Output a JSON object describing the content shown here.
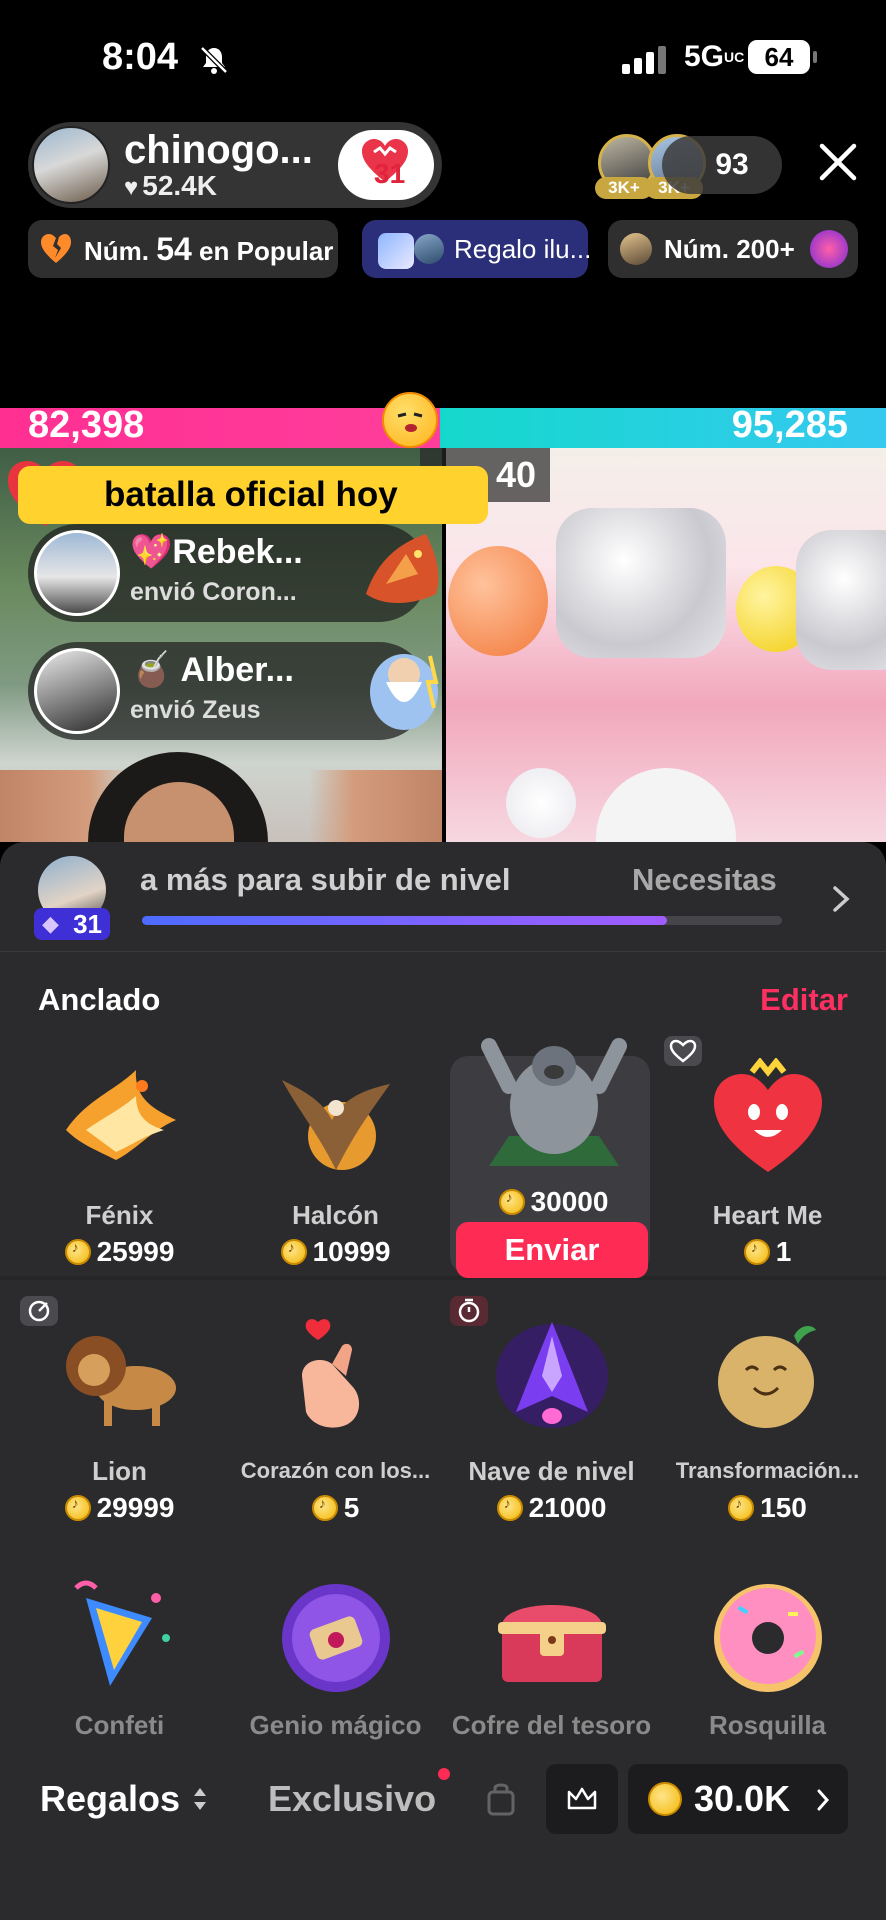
{
  "status_bar": {
    "time": "8:04",
    "network": "5G",
    "network_sup": "UC",
    "battery": "64"
  },
  "host": {
    "name": "chinogo...",
    "likes": "52.4K",
    "badge_number": "31"
  },
  "viewers": {
    "top_tags": [
      "3K+",
      "3K+"
    ],
    "count": "93"
  },
  "chips": [
    {
      "prefix": "Núm. ",
      "big": "54",
      "suffix": " en Popular"
    },
    {
      "label": "Regalo ilu..."
    },
    {
      "label": "Núm. 200+"
    }
  ],
  "battle": {
    "score_left": "82,398",
    "score_right": "95,285",
    "timer": "40",
    "banner": "batalla oficial  hoy"
  },
  "gift_notifications": [
    {
      "name": "Rebek...",
      "sub": "envió Coron..."
    },
    {
      "name": "Alber...",
      "sub": "envió Zeus"
    }
  ],
  "level": {
    "badge": "31",
    "text": "a más para subir de nivel",
    "text2": "Necesitas",
    "progress": 0.82
  },
  "section": {
    "title": "Anclado",
    "edit": "Editar"
  },
  "gifts_pinned": [
    {
      "name": "Fénix",
      "price": "25999"
    },
    {
      "name": "Halcón",
      "price": "10999"
    },
    {
      "name": "Gorila",
      "price": "30000"
    },
    {
      "name": "Heart Me",
      "price": "1"
    }
  ],
  "send_label": "Enviar",
  "gifts_row2": [
    {
      "name": "Lion",
      "price": "29999"
    },
    {
      "name": "Corazón con los...",
      "price": "5"
    },
    {
      "name": "Nave de nivel",
      "price": "21000"
    },
    {
      "name": "Transformación...",
      "price": "150"
    }
  ],
  "gifts_row3": [
    {
      "name": "Confeti"
    },
    {
      "name": "Genio mágico"
    },
    {
      "name": "Cofre del tesoro"
    },
    {
      "name": "Rosquilla"
    }
  ],
  "bottom": {
    "tab_gifts": "Regalos",
    "tab_exclusive": "Exclusivo",
    "coins": "30.0K"
  },
  "colors": {
    "accent": "#fe2c55",
    "battle_left": "#ff2f92",
    "battle_right": "#15d8cc",
    "banner": "#ffd22e",
    "panel": "#2b2b2e"
  }
}
